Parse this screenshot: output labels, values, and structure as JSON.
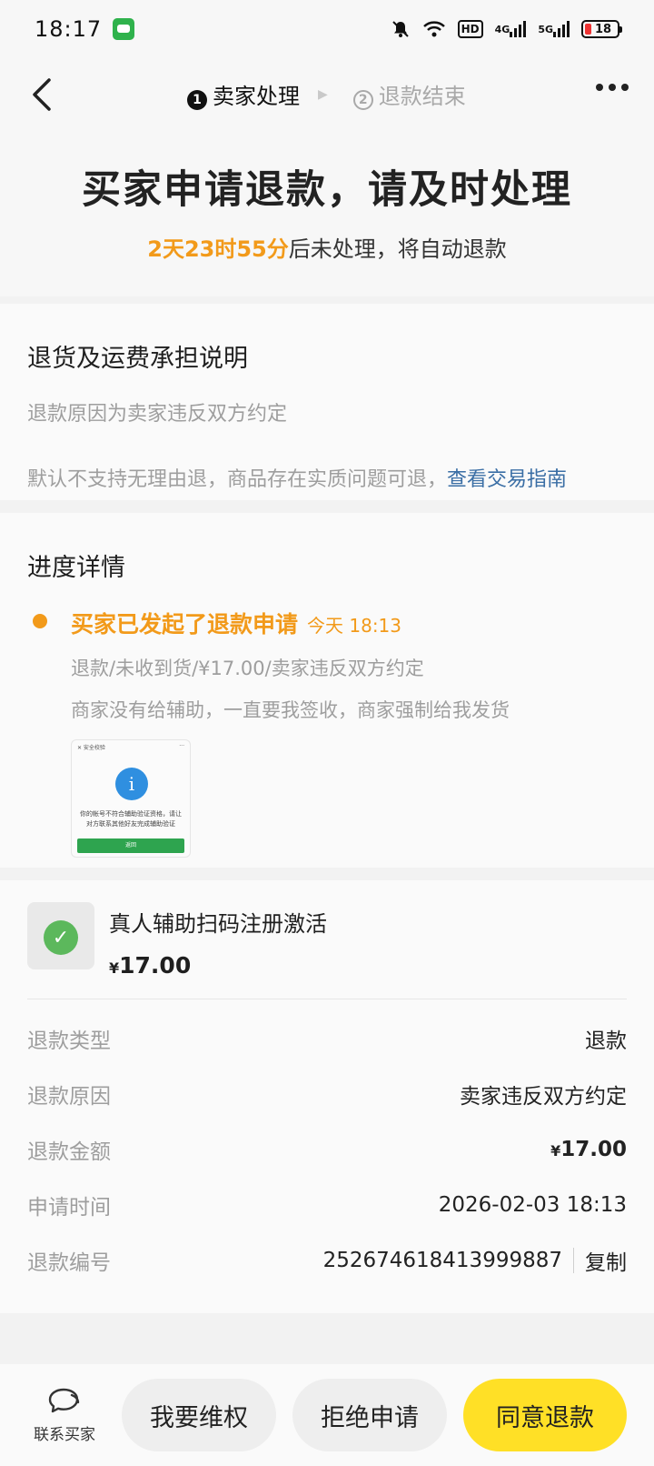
{
  "status_bar": {
    "time": "18:17",
    "network1": "4G",
    "network2": "5G",
    "hd": "HD",
    "battery": "18"
  },
  "nav": {
    "step1_num": "1",
    "step1_label": "卖家处理",
    "step2_num": "2",
    "step2_label": "退款结束"
  },
  "header": {
    "title": "买家申请退款，请及时处理",
    "countdown": "2天23时55分",
    "countdown_suffix": "后未处理，将自动退款"
  },
  "policy": {
    "title": "退货及运费承担说明",
    "reason_line": "退款原因为卖家违反双方约定",
    "note": "默认不支持无理由退，商品存在实质问题可退，",
    "link": "查看交易指南"
  },
  "progress": {
    "title": "进度详情",
    "event_title": "买家已发起了退款申请",
    "event_time": "今天 18:13",
    "detail": "退款/未收到货/¥17.00/卖家违反双方约定",
    "comment": "商家没有给辅助，一直要我签收，商家强制给我发货",
    "evidence": {
      "header_left": "✕ 安全校验",
      "header_right": "···",
      "message": "你的帐号不符合辅助验证资格，请让对方联系其他好友完成辅助验证",
      "button": "返回"
    }
  },
  "product": {
    "name": "真人辅助扫码注册激活",
    "price_symbol": "¥",
    "price": "17.00"
  },
  "details": {
    "type_label": "退款类型",
    "type_value": "退款",
    "reason_label": "退款原因",
    "reason_value": "卖家违反双方约定",
    "amount_label": "退款金额",
    "amount_symbol": "¥",
    "amount_value": "17.00",
    "time_label": "申请时间",
    "time_value": "2026-02-03 18:13",
    "number_label": "退款编号",
    "number_value": "252674618413999887",
    "copy": "复制"
  },
  "bottom": {
    "contact": "联系买家",
    "rights": "我要维权",
    "reject": "拒绝申请",
    "agree": "同意退款"
  },
  "colors": {
    "accent_orange": "#f29a1a",
    "primary_yellow": "#ffe026",
    "link_blue": "#3a6ea5"
  }
}
